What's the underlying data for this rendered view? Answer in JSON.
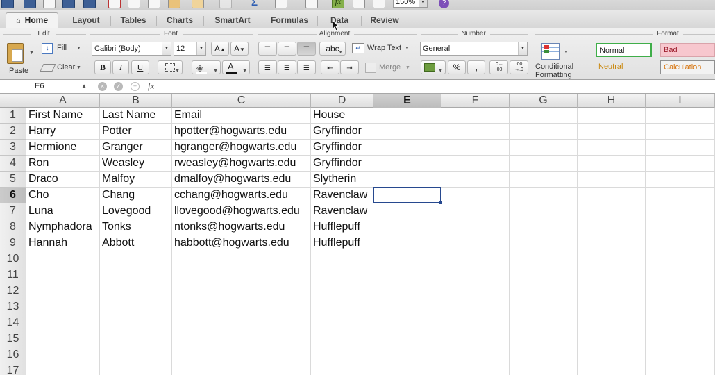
{
  "qat": {
    "zoom": "150%"
  },
  "tabs": [
    {
      "label": "Home",
      "active": true
    },
    {
      "label": "Layout",
      "active": false
    },
    {
      "label": "Tables",
      "active": false
    },
    {
      "label": "Charts",
      "active": false
    },
    {
      "label": "SmartArt",
      "active": false
    },
    {
      "label": "Formulas",
      "active": false
    },
    {
      "label": "Data",
      "active": false
    },
    {
      "label": "Review",
      "active": false
    }
  ],
  "ribbon": {
    "groups": {
      "edit": "Edit",
      "font": "Font",
      "alignment": "Alignment",
      "number": "Number",
      "format": "Format"
    },
    "paste": "Paste",
    "fill": "Fill",
    "clear": "Clear",
    "font_name": "Calibri (Body)",
    "font_size": "12",
    "grow_font": "A",
    "shrink_font": "A",
    "bold": "B",
    "italic": "I",
    "underline": "U",
    "font_color_letter": "A",
    "orientation": "abc",
    "wrap_text": "Wrap Text",
    "merge": "Merge",
    "number_format": "General",
    "percent": "%",
    "comma": ",",
    "increase_decimal": ".0←\n.00",
    "decrease_decimal": ".00\n→.0",
    "conditional_line1": "Conditional",
    "conditional_line2": "Formatting",
    "styles": {
      "normal": "Normal",
      "bad": "Bad",
      "neutral": "Neutral",
      "calculation": "Calculation"
    },
    "colors": {
      "bad_bg": "#f7c7ce",
      "bad_fg": "#9c1c2b",
      "neutral_fg": "#c9860a",
      "calc_fg": "#d6720b",
      "normal_border": "#3fae49"
    }
  },
  "formula_bar": {
    "cell_ref": "E6",
    "fx": "fx",
    "value": ""
  },
  "columns": [
    "A",
    "B",
    "C",
    "D",
    "E",
    "F",
    "G",
    "H",
    "I"
  ],
  "selected_column": "E",
  "selected_row": 6,
  "row_numbers": [
    "1",
    "2",
    "3",
    "4",
    "5",
    "6",
    "7",
    "8",
    "9",
    "10",
    "11",
    "12",
    "13",
    "14",
    "15",
    "16",
    "17"
  ],
  "rows": [
    [
      "First Name",
      "Last Name",
      "Email",
      "House"
    ],
    [
      "Harry",
      "Potter",
      "hpotter@hogwarts.edu",
      "Gryffindor"
    ],
    [
      "Hermione",
      "Granger",
      "hgranger@hogwarts.edu",
      "Gryffindor"
    ],
    [
      "Ron",
      "Weasley",
      "rweasley@hogwarts.edu",
      "Gryffindor"
    ],
    [
      "Draco",
      "Malfoy",
      "dmalfoy@hogwarts.edu",
      "Slytherin"
    ],
    [
      "Cho",
      "Chang",
      "cchang@hogwarts.edu",
      "Ravenclaw"
    ],
    [
      "Luna",
      "Lovegood",
      "llovegood@hogwarts.edu",
      "Ravenclaw"
    ],
    [
      "Nymphadora",
      "Tonks",
      "ntonks@hogwarts.edu",
      "Hufflepuff"
    ],
    [
      "Hannah",
      "Abbott",
      "habbott@hogwarts.edu",
      "Hufflepuff"
    ]
  ]
}
